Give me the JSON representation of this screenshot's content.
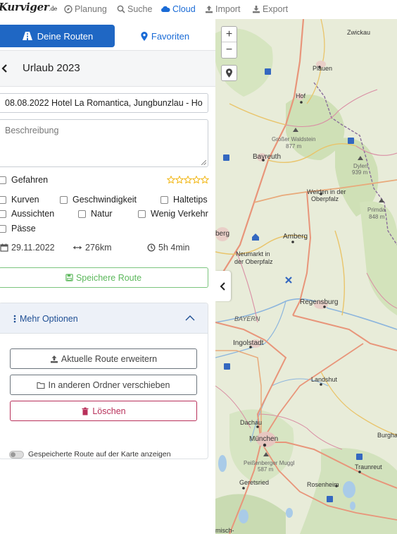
{
  "brand": {
    "logo_text": "Kurviger",
    "logo_suffix": ".de"
  },
  "nav": {
    "items": [
      {
        "label": "Planung",
        "icon": "compass-icon",
        "active": false
      },
      {
        "label": "Suche",
        "icon": "search-icon",
        "active": false
      },
      {
        "label": "Cloud",
        "icon": "cloud-icon",
        "active": true
      },
      {
        "label": "Import",
        "icon": "upload-icon",
        "active": false
      },
      {
        "label": "Export",
        "icon": "download-icon",
        "active": false
      }
    ]
  },
  "tabs": {
    "routes_label": "Deine Routen",
    "favorites_label": "Favoriten"
  },
  "route": {
    "folder_title": "Urlaub 2023",
    "name_value": "08.08.2022 Hotel La Romantica, Jungbunzlau - Ho",
    "description_placeholder": "Beschreibung",
    "driven_label": "Gefahren",
    "rating_stars": 0,
    "rating_max": 5,
    "tags": {
      "kurven": "Kurven",
      "geschwindigkeit": "Geschwindigkeit",
      "haltetips": "Haltetips",
      "aussichten": "Aussichten",
      "natur": "Natur",
      "wenig_verkehr": "Wenig Verkehr",
      "paesse": "Pässe"
    },
    "date": "29.11.2022",
    "distance": "276km",
    "duration": "5h 4min",
    "save_label": "Speichere Route"
  },
  "more_options": {
    "title": "Mehr Optionen",
    "extend_label": "Aktuelle Route erweitern",
    "move_label": "In anderen Ordner verschieben",
    "delete_label": "Löschen",
    "show_on_map_label": "Gespeicherte Route auf der Karte anzeigen",
    "show_on_map_enabled": false
  },
  "map": {
    "zoom_in": "+",
    "zoom_out": "−",
    "labels": {
      "zwickau": "Zwickau",
      "plauen": "Plauen",
      "hof": "Hof",
      "grosser_waldstein": "Großer Waldstein",
      "gw_height": "877 m",
      "bayreuth": "Bayreuth",
      "dylen": "Dylen",
      "dylen_height": "939 m",
      "weiden1": "Weiden in der",
      "weiden2": "Oberpfalz",
      "primda": "Primda",
      "primda_height": "848 m",
      "nuernberg": "berg",
      "amberg": "Amberg",
      "neumarkt1": "Neumarkt in",
      "neumarkt2": "der Oberpfalz",
      "regensburg": "Regensburg",
      "bayern": "BAYERN",
      "ingolstadt": "Ingolstadt",
      "landshut": "Landshut",
      "dachau": "Dachau",
      "muenchen": "München",
      "burgha": "Burgha",
      "peissenberg": "Peißenberger Muggl",
      "pm_height": "587 m",
      "traunreut": "Traunreut",
      "geretsried": "Geretsried",
      "rosenheim": "Rosenheim",
      "garmisch": "misch-"
    }
  },
  "colors": {
    "primary": "#1f67c4",
    "success": "#5cb85c",
    "danger": "#b8305a",
    "star": "#f0b000"
  }
}
